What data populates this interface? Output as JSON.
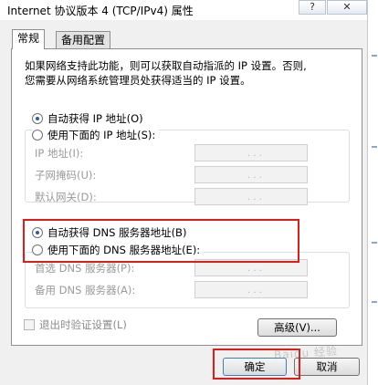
{
  "window": {
    "title": "Internet 协议版本 4 (TCP/IPv4) 属性",
    "help_label": "?",
    "close_label": "✕"
  },
  "tabs": [
    {
      "label": "常规"
    },
    {
      "label": "备用配置"
    }
  ],
  "description": {
    "line1": "如果网络支持此功能，则可以获取自动指派的 IP 设置。否则,",
    "line2": "您需要从网络系统管理员处获得适当的 IP 设置。"
  },
  "ip": {
    "auto_label": "自动获得 IP 地址(O)",
    "auto_selected": true,
    "manual_label": "使用下面的 IP 地址(S):",
    "fields": [
      {
        "label": "IP 地址(I):",
        "value": ". . ."
      },
      {
        "label": "子网掩码(U):",
        "value": ". . ."
      },
      {
        "label": "默认网关(D):",
        "value": ". . ."
      }
    ]
  },
  "dns": {
    "auto_label": "自动获得 DNS 服务器地址(B)",
    "auto_selected": true,
    "manual_label": "使用下面的 DNS 服务器地址(E):",
    "fields": [
      {
        "label": "首选 DNS 服务器(P):",
        "value": ". . ."
      },
      {
        "label": "备用 DNS 服务器(A):",
        "value": ". . ."
      }
    ]
  },
  "validate_label": "退出时验证设置(L)",
  "advanced_label": "高级(V)...",
  "ok_label": "确定",
  "cancel_label": "取消",
  "watermark": "Baidu 经验",
  "colors": {
    "highlight": "#e01b1b",
    "radio_on": "#2a5ea8"
  }
}
